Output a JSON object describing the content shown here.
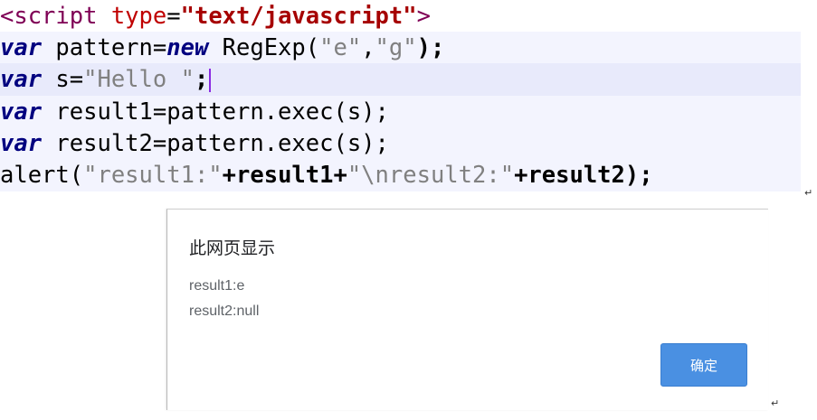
{
  "code": {
    "l1_open": "<script",
    "l1_attr": "type",
    "l1_eq": "=",
    "l1_val": "\"text/javascript\"",
    "l1_close": ">",
    "var_kw": "var",
    "new_kw": "new",
    "l2_a": " pattern=",
    "l2_b": " RegExp(",
    "l2_s1": "\"e\"",
    "l2_comma": ",",
    "l2_s2": "\"g\"",
    "l2_end": ");",
    "l3_a": " s=",
    "l3_s": "\"Hello \"",
    "l3_end": ";",
    "l4_a": " result1=pattern.exec(s);",
    "l5_a": " result2=pattern.exec(s);",
    "l6_a": "alert(",
    "l6_s1": "\"result1:\"",
    "l6_b": "+result1+",
    "l6_s2": "\"\\nresult2:\"",
    "l6_c": "+result2);"
  },
  "para_mark": "↵",
  "dialog": {
    "title": "此网页显示",
    "message_line1": "result1:e",
    "message_line2": "result2:null",
    "ok_label": "确定"
  },
  "colors": {
    "keyword": "#00007f",
    "tag": "#7f0055",
    "string": "#808080",
    "button": "#4a90e2"
  }
}
